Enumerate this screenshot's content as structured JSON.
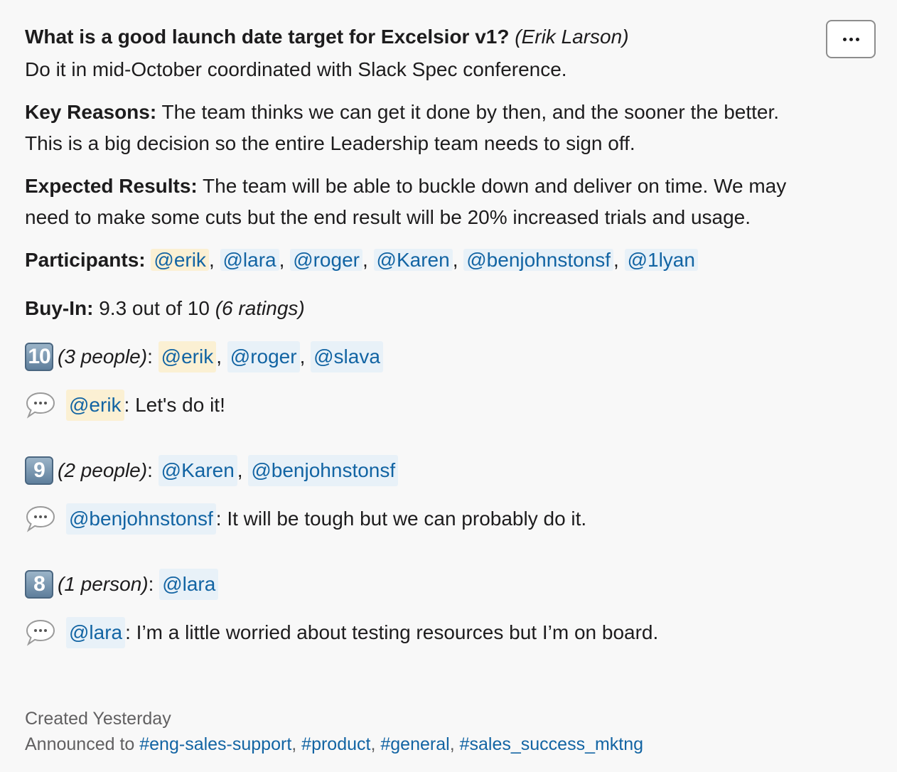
{
  "decision": {
    "question": "What is a good launch date target for Excelsior v1?",
    "author": "(Erik Larson)",
    "answer": "Do it in mid-October coordinated with Slack Spec conference.",
    "key_reasons_label": "Key Reasons:",
    "key_reasons_text": " The team thinks we can get it done by then, and the sooner the better. This is a big decision so the entire Leadership team needs to sign off.",
    "expected_results_label": "Expected Results:",
    "expected_results_text": "  The team will be able to buckle down and deliver on time. We may need to make some cuts but the end result will be 20% increased trials and usage.",
    "participants_label": "Participants:",
    "participants": [
      "@erik",
      "@lara",
      "@roger",
      "@Karen",
      "@benjohnstonsf",
      "@1lyan"
    ],
    "buyin_label": "Buy-In:",
    "buyin_score": " 9.3 out of 10 ",
    "buyin_count": "(6 ratings)"
  },
  "ratings": [
    {
      "score": "10",
      "count_label": "(3 people)",
      "people": [
        "@erik",
        "@roger",
        "@slava"
      ],
      "comment_user": "@erik",
      "comment_text": ": Let's do it!"
    },
    {
      "score": "9",
      "count_label": "(2 people)",
      "people": [
        "@Karen",
        "@benjohnstonsf"
      ],
      "comment_user": "@benjohnstonsf",
      "comment_text": ": It will be tough but we can probably do it."
    },
    {
      "score": "8",
      "count_label": "(1 person)",
      "people": [
        "@lara"
      ],
      "comment_user": "@lara",
      "comment_text": ": I’m a little worried about testing resources but I’m on board."
    }
  ],
  "footer": {
    "created": "Created Yesterday",
    "announced_prefix": "Announced to ",
    "channels": [
      "#eng-sales-support",
      "#product",
      "#general",
      "#sales_success_mktng"
    ]
  },
  "icons": {
    "more": "more-horizontal-icon",
    "comment": "speech-bubble-icon",
    "score": "keycap-number-icon"
  },
  "colors": {
    "link": "#1264a3",
    "mention_bg": "#e8f1f8",
    "self_mention_bg": "#fbf0d3",
    "text": "#1d1c1d",
    "muted": "#616061"
  }
}
